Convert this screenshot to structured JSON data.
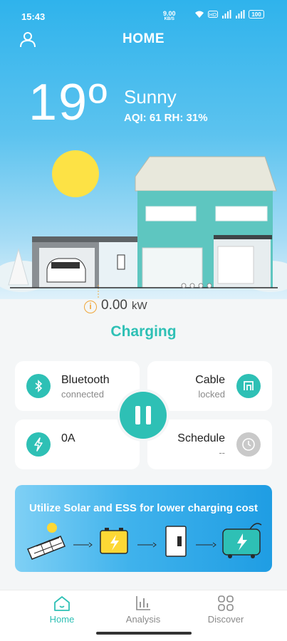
{
  "status_bar": {
    "time": "15:43",
    "net_speed": "9.00",
    "net_unit": "KB/S",
    "battery": "100"
  },
  "header": {
    "title": "HOME",
    "user_icon": "user-icon"
  },
  "weather": {
    "temperature": "19º",
    "condition": "Sunny",
    "aqi_rh": "AQI: 61   RH: 31%"
  },
  "power": {
    "value": "0.00",
    "unit": "kW",
    "info_icon": "info-icon"
  },
  "status": "Charging",
  "cards": {
    "bluetooth": {
      "title": "Bluetooth",
      "subtitle": "connected",
      "icon": "bluetooth-icon"
    },
    "cable": {
      "title": "Cable",
      "subtitle": "locked",
      "icon": "cable-lock-icon"
    },
    "current": {
      "title": "0A",
      "icon": "lightning-icon"
    },
    "schedule": {
      "title": "Schedule",
      "subtitle": "--",
      "icon": "clock-icon"
    }
  },
  "banner": {
    "title": "Utilize Solar and ESS for lower charging cost"
  },
  "nav": {
    "items": [
      {
        "label": "Home",
        "icon": "home-icon",
        "active": true
      },
      {
        "label": "Analysis",
        "icon": "bar-chart-icon",
        "active": false
      },
      {
        "label": "Discover",
        "icon": "grid-icon",
        "active": false
      }
    ]
  },
  "colors": {
    "accent": "#2ec0b5",
    "sky": "#2fb3ec",
    "info": "#f0a63a"
  }
}
